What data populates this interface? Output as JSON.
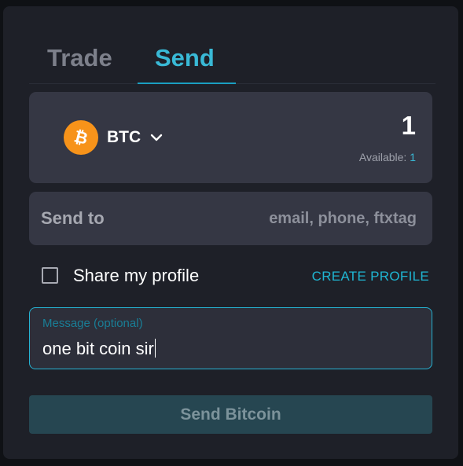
{
  "tabs": [
    {
      "label": "Trade",
      "active": false
    },
    {
      "label": "Send",
      "active": true
    }
  ],
  "asset": {
    "coin": "BTC",
    "amount": "1",
    "available_label": "Available:",
    "available_value": "1",
    "icon": "bitcoin-logo",
    "icon_color": "#f7931a"
  },
  "send_to": {
    "label": "Send to",
    "placeholder": "email, phone, ftxtag"
  },
  "share_profile": {
    "label": "Share my profile",
    "checked": false,
    "create_profile_label": "CREATE PROFILE"
  },
  "message": {
    "label": "Message (optional)",
    "value": "one bit coin sir"
  },
  "send_button": {
    "label": "Send Bitcoin"
  },
  "colors": {
    "accent": "#39b9d6",
    "panel": "#1e2028",
    "card": "#353744",
    "button_disabled": "#264651"
  }
}
